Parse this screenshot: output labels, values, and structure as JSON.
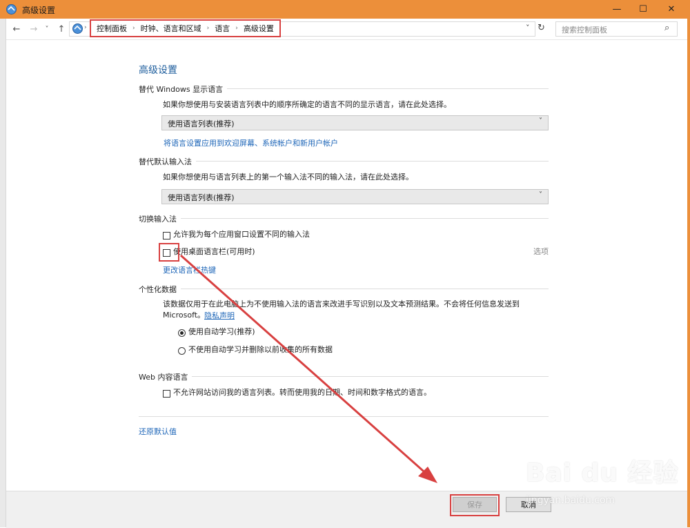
{
  "window": {
    "title": "高级设置",
    "controls": {
      "minimize": "—",
      "maximize": "☐",
      "close": "✕"
    },
    "accent_color": "#ec8f3a"
  },
  "navbar": {
    "back": "←",
    "forward": "→",
    "recent": "˅",
    "up": "↑",
    "breadcrumb": [
      "控制面板",
      "时钟、语言和区域",
      "语言",
      "高级设置"
    ],
    "crumb_sep": "›",
    "dropdown_glyph": "˅",
    "refresh": "↻",
    "search_placeholder": "搜索控制面板",
    "search_icon": "⌕"
  },
  "page": {
    "heading": "高级设置",
    "display_language": {
      "title": "替代 Windows 显示语言",
      "description": "如果你想使用与安装语言列表中的顺序所确定的语言不同的显示语言，请在此处选择。",
      "dropdown_value": "使用语言列表(推荐)",
      "link": "将语言设置应用到欢迎屏幕、系统帐户和新用户帐户"
    },
    "input_method": {
      "title": "替代默认输入法",
      "description": "如果你想使用与语言列表上的第一个输入法不同的输入法，请在此处选择。",
      "dropdown_value": "使用语言列表(推荐)"
    },
    "switch_input": {
      "title": "切换输入法",
      "checkbox1": "允许我为每个应用窗口设置不同的输入法",
      "checkbox2": "使用桌面语言栏(可用时)",
      "options_label": "选项",
      "link": "更改语言栏热键"
    },
    "personalization": {
      "title": "个性化数据",
      "description_line1": "该数据仅用于在此电脑上为不使用输入法的语言来改进手写识别以及文本预测结果。不会将任何信息发送到",
      "description_line2": "Microsoft。",
      "privacy_link": "隐私声明",
      "radio1": "使用自动学习(推荐)",
      "radio2": "不使用自动学习并删除以前收集的所有数据"
    },
    "web_language": {
      "title": "Web 内容语言",
      "checkbox": "不允许网站访问我的语言列表。转而使用我的日期、时间和数字格式的语言。"
    },
    "restore_defaults": "还原默认值"
  },
  "footer": {
    "save": "保存",
    "cancel": "取消"
  },
  "watermark": {
    "brand": "Bai du 经验",
    "url": "jingyan.baidu.com"
  },
  "highlight_color": "#d84040"
}
